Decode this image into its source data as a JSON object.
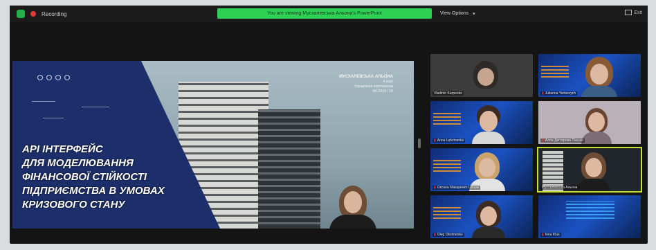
{
  "topbar": {
    "recording_label": "Recording",
    "share_banner": "You are viewing Мусхалевська Альона's PowerPoint",
    "view_options": "View Options",
    "exit_label": "Exit"
  },
  "slide": {
    "title_lines": [
      "API ІНТЕРФЕЙС",
      "ДЛЯ МОДЕЛЮВАННЯ",
      "ФІНАНСОВОЇ СТІЙКОСТІ",
      "ПІДПРИЄМСТВА В УМОВАХ",
      "КРИЗОВОГО СТАНУ"
    ],
    "author_name": "МУСХАЛЕВСЬКА АЛЬОНА",
    "author_course": "4 курс",
    "author_specialty": "Управління персоналом",
    "author_group": "ФК-2018 / 1Б"
  },
  "participants": [
    {
      "name": "Vladimir Karpenko",
      "bg": "gray"
    },
    {
      "name": "Julianna Yurtsevych",
      "bg": "blue"
    },
    {
      "name": "Anna Lahvinenko",
      "bg": "blue"
    },
    {
      "name": "Алла Дигтярева Пасько",
      "bg": "lav"
    },
    {
      "name": "Оксана Макаренко Гріщак",
      "bg": "blue"
    },
    {
      "name": "Мусхалевська Альона",
      "bg": "dark",
      "active": true
    },
    {
      "name": "Oleg Oksimenko",
      "bg": "blue"
    },
    {
      "name": "Inna Klus",
      "bg": "blue"
    }
  ]
}
